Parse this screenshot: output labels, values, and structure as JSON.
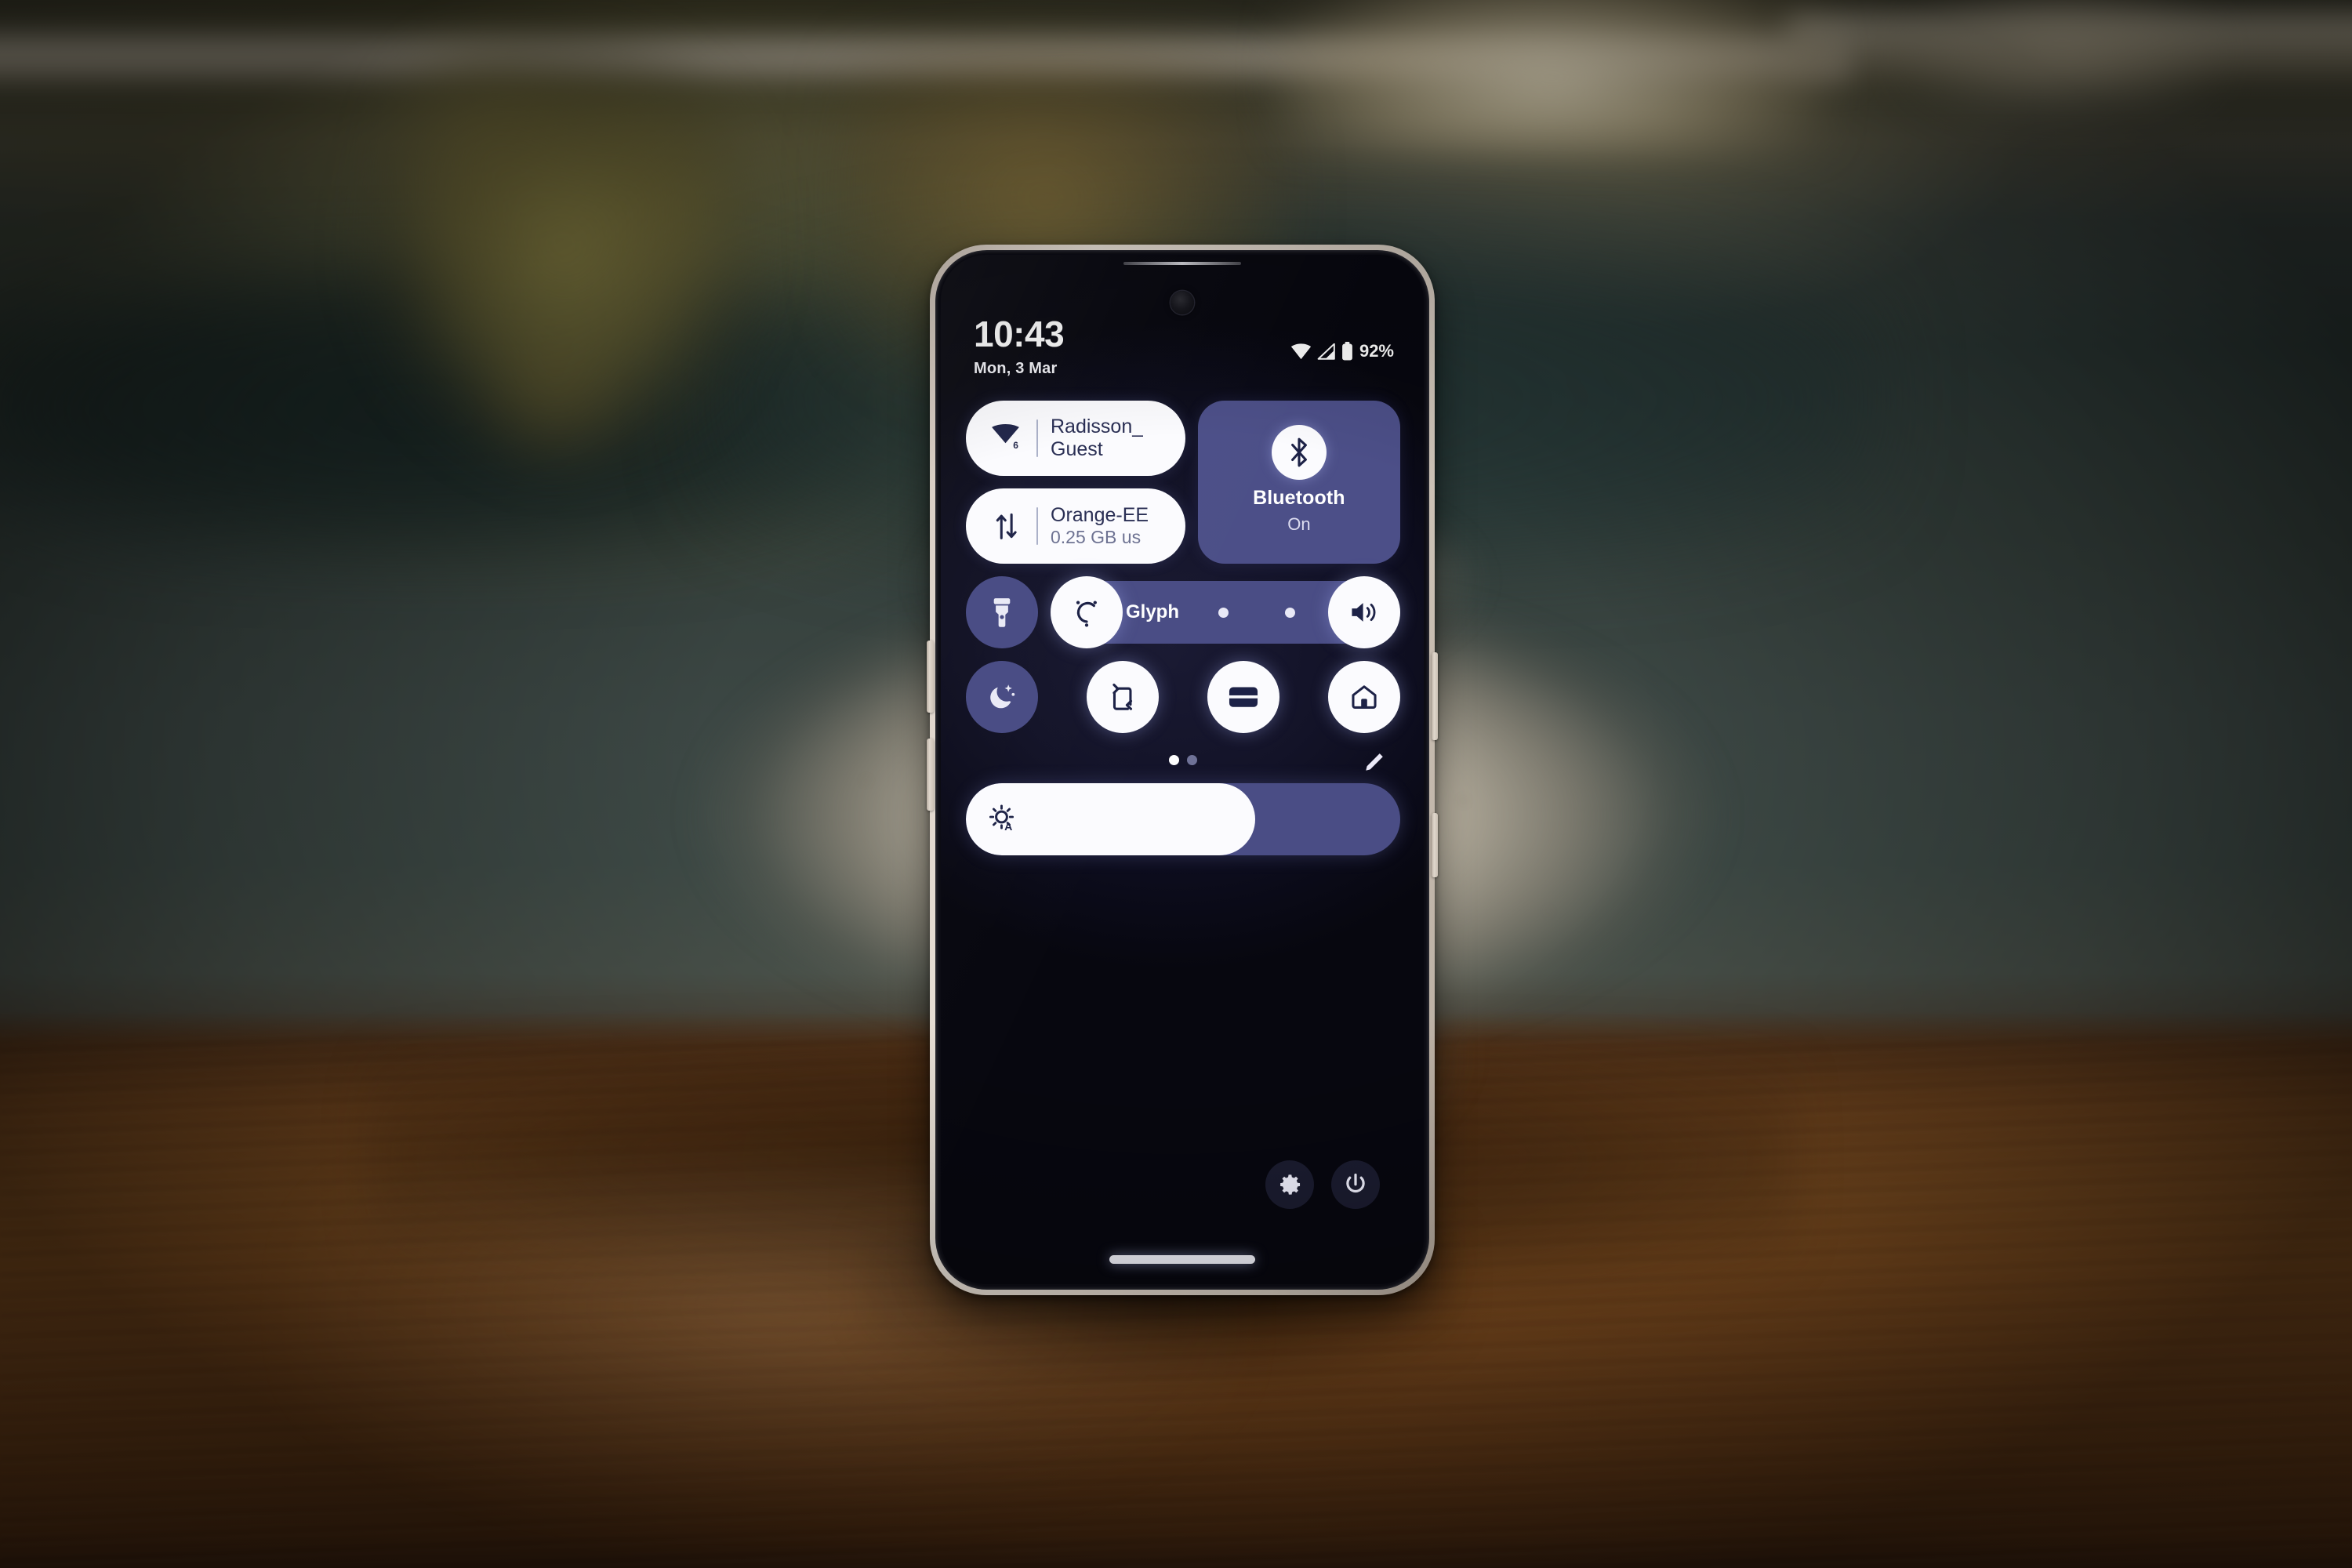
{
  "device": {
    "kind": "smartphone",
    "scene": "phone standing on wooden table in front of blurred stone vase"
  },
  "status_bar": {
    "clock": "10:43",
    "date": "Mon, 3 Mar",
    "battery_percent": "92%",
    "icons": [
      "wifi-icon",
      "cellular-signal-icon",
      "battery-icon"
    ]
  },
  "quick_settings": {
    "wifi_tile": {
      "icon": "wifi-icon",
      "badge": "6",
      "title": "Radisson_",
      "subtitle": "Guest"
    },
    "data_tile": {
      "icon": "mobile-data-icon",
      "title": "Orange-EE",
      "subtitle": "0.25 GB us"
    },
    "bluetooth_tile": {
      "icon": "bluetooth-icon",
      "title": "Bluetooth",
      "state": "On"
    },
    "row3": {
      "flashlight": {
        "icon": "flashlight-icon",
        "state": "off"
      },
      "glyph": {
        "icon": "glyph-icon",
        "label": "Glyph",
        "state": "on"
      },
      "volume": {
        "icon": "volume-icon",
        "state": "on"
      }
    },
    "row4": [
      {
        "icon": "bedtime-moon-icon",
        "state": "off"
      },
      {
        "icon": "auto-rotate-icon",
        "state": "on"
      },
      {
        "icon": "wallet-icon",
        "state": "on"
      },
      {
        "icon": "smart-home-icon",
        "state": "on"
      }
    ],
    "pages": {
      "count": 2,
      "active_index": 0
    },
    "edit_button": {
      "icon": "pencil-edit-icon"
    },
    "brightness": {
      "icon": "auto-brightness-icon",
      "auto_letter": "A",
      "level_percent": 62
    },
    "footer": {
      "settings": {
        "icon": "gear-icon"
      },
      "power": {
        "icon": "power-icon"
      }
    },
    "nav_bar": {
      "kind": "gesture-handle"
    }
  },
  "colors": {
    "tile_on_bg": "#fbfbfe",
    "tile_off_bg": "#4a4d85",
    "tile_accent": "#4c4f88",
    "tile_fg_dark": "#1d2247",
    "screen_bg": "#07070f",
    "frame": "#ded4ca",
    "table": "#7d4d20"
  }
}
